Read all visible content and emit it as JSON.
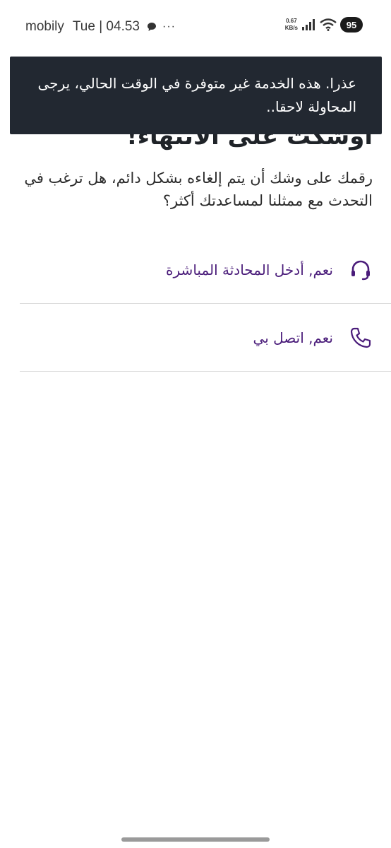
{
  "status_bar": {
    "carrier": "mobily",
    "time": "Tue | 04.53",
    "more": "···",
    "speed_value": "0.67",
    "speed_unit": "KB/s",
    "battery": "95"
  },
  "toast": {
    "message": "عذرا. هذه الخدمة غير متوفرة في الوقت الحالي، يرجى المحاولة لاحقا.."
  },
  "content": {
    "heading": "أوشكت على الانتهاء!",
    "subtitle": "رقمك على وشك أن يتم إلغاءه بشكل دائم، هل ترغب في التحدث مع ممثلنا لمساعدتك أكثر؟"
  },
  "options": [
    {
      "label": "نعم, أدخل المحادثة المباشرة",
      "icon": "headset-icon"
    },
    {
      "label": "نعم, اتصل بي",
      "icon": "phone-icon"
    }
  ],
  "colors": {
    "accent": "#4a1c7a",
    "toast_bg": "#222831",
    "divider": "#dcdcdc"
  }
}
